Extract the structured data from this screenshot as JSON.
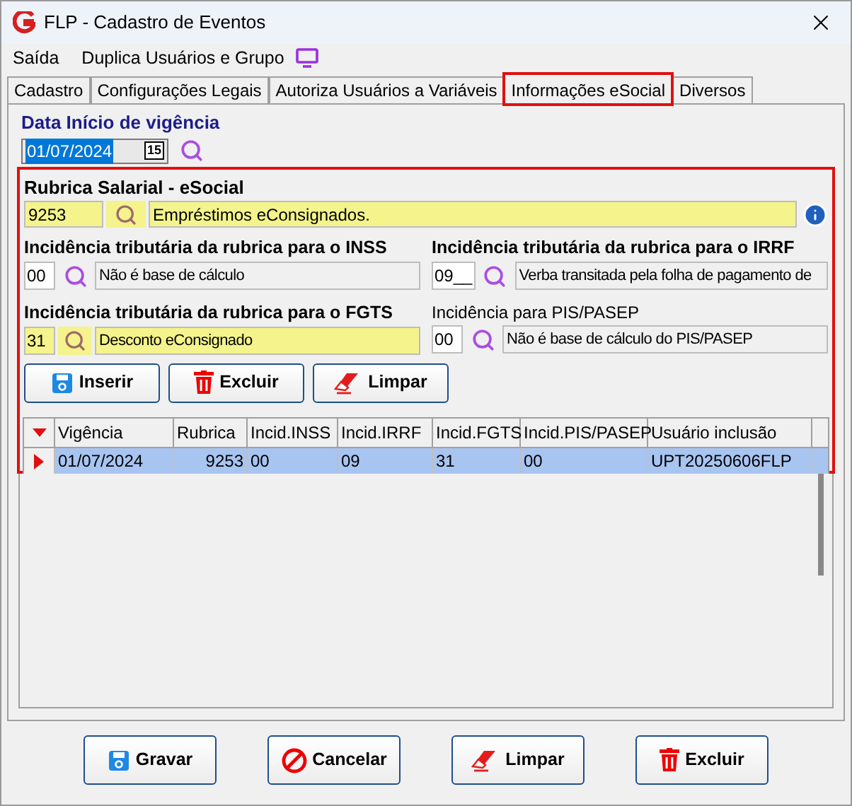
{
  "window": {
    "title": "FLP - Cadastro de Eventos"
  },
  "menu": [
    {
      "label": "Saída"
    },
    {
      "label": "Duplica Usuários e Grupo"
    }
  ],
  "tabs": [
    {
      "label": "Cadastro",
      "selected": false,
      "highlighted": false
    },
    {
      "label": "Configurações Legais",
      "selected": false,
      "highlighted": false
    },
    {
      "label": "Autoriza Usuários a Variáveis",
      "selected": false,
      "highlighted": false
    },
    {
      "label": "Informações eSocial",
      "selected": true,
      "highlighted": true
    },
    {
      "label": "Diversos",
      "selected": false,
      "highlighted": false
    }
  ],
  "start_date": {
    "label": "Data Início de vigência",
    "value": "01/07/2024",
    "calendar_button": "15"
  },
  "esocial": {
    "highlighted": true,
    "rubrica": {
      "label": "Rubrica Salarial - eSocial",
      "code": "9253",
      "description": "Empréstimos eConsignados."
    },
    "fields": [
      {
        "label": "Incidência tributária da rubrica para o INSS",
        "emphasized": true,
        "highlighted": false,
        "code": "00",
        "description": "Não é base de cálculo"
      },
      {
        "label": "Incidência tributária da rubrica para o IRRF",
        "emphasized": true,
        "highlighted": false,
        "code": "09__",
        "description": "Verba transitada pela folha de pagamento de"
      },
      {
        "label": "Incidência tributária da rubrica para o FGTS",
        "emphasized": true,
        "highlighted": true,
        "code": "31",
        "description": "Desconto eConsignado"
      },
      {
        "label": "Incidência para PIS/PASEP",
        "emphasized": false,
        "highlighted": false,
        "code": "00",
        "description": "Não é base de cálculo do PIS/PASEP"
      }
    ],
    "actions": [
      {
        "label": "Inserir",
        "kind": "save"
      },
      {
        "label": "Excluir",
        "kind": "delete"
      },
      {
        "label": "Limpar",
        "kind": "clear"
      }
    ]
  },
  "grid": {
    "columns": [
      "Vigência",
      "Rubrica",
      "Incid.INSS",
      "Incid.IRRF",
      "Incid.FGTS",
      "Incid.PIS/PASEP",
      "Usuário inclusão"
    ],
    "rows": [
      {
        "selected": true,
        "cells": [
          "01/07/2024",
          "9253",
          "00",
          "09",
          "31",
          "00",
          "UPT20250606FLP"
        ]
      }
    ]
  },
  "footer_buttons": [
    {
      "label": "Gravar",
      "kind": "save"
    },
    {
      "label": "Cancelar",
      "kind": "cancel"
    },
    {
      "label": "Limpar",
      "kind": "clear"
    },
    {
      "label": "Excluir",
      "kind": "delete"
    }
  ]
}
